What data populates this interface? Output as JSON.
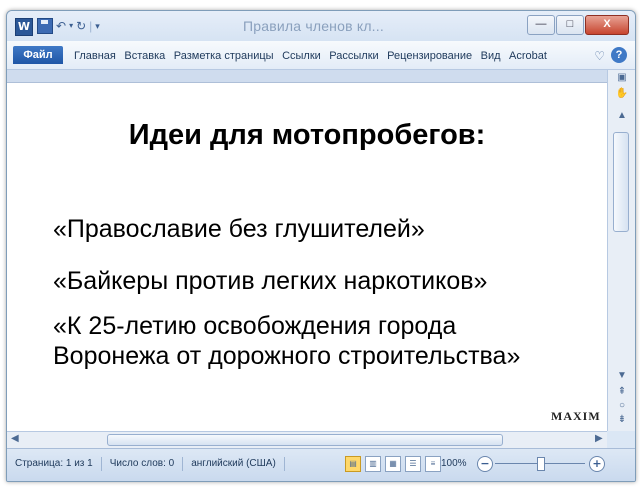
{
  "window": {
    "title": "Правила членов кл..."
  },
  "titlebar": {
    "app_icon": "W",
    "minimize": "—",
    "maximize": "□",
    "close": "X"
  },
  "ribbon": {
    "file_tab": "Файл",
    "tabs": [
      "Главная",
      "Вставка",
      "Разметка страницы",
      "Ссылки",
      "Рассылки",
      "Рецензирование",
      "Вид",
      "Acrobat"
    ],
    "expand_icon": "chevron-icon",
    "help": "?"
  },
  "document": {
    "title": "Идеи для мотопробегов:",
    "lines": [
      "«Православие без глушителей»",
      "«Байкеры против легких наркотиков»",
      "«К 25-летию освобождения города",
      "Воронежа от дорожного строительства»"
    ],
    "watermark": "MAXIM"
  },
  "statusbar": {
    "page": "Страница: 1 из 1",
    "words": "Число слов: 0",
    "language": "английский (США)",
    "zoom": "100%",
    "zoom_level": 1.0
  },
  "colors": {
    "accent": "#1f56a6",
    "frame": "#dbe7f5"
  }
}
